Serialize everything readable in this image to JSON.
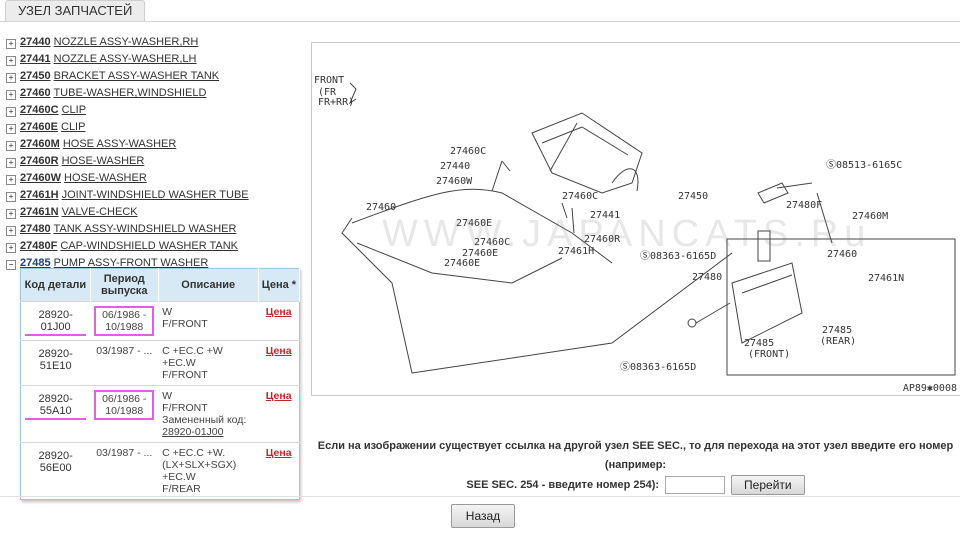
{
  "tab": {
    "title": "УЗЕЛ ЗАПЧАСТЕЙ"
  },
  "tree": [
    {
      "toggle": "+",
      "code": "27440",
      "name": "NOZZLE ASSY-WASHER,RH"
    },
    {
      "toggle": "+",
      "code": "27441",
      "name": "NOZZLE ASSY-WASHER,LH"
    },
    {
      "toggle": "+",
      "code": "27450",
      "name": "BRACKET ASSY-WASHER TANK"
    },
    {
      "toggle": "+",
      "code": "27460",
      "name": "TUBE-WASHER,WINDSHIELD"
    },
    {
      "toggle": "+",
      "code": "27460C",
      "name": "CLIP"
    },
    {
      "toggle": "+",
      "code": "27460E",
      "name": "CLIP"
    },
    {
      "toggle": "+",
      "code": "27460M",
      "name": "HOSE ASSY-WASHER"
    },
    {
      "toggle": "+",
      "code": "27460R",
      "name": "HOSE-WASHER"
    },
    {
      "toggle": "+",
      "code": "27460W",
      "name": "HOSE-WASHER"
    },
    {
      "toggle": "+",
      "code": "27461H",
      "name": "JOINT-WINDSHIELD WASHER TUBE"
    },
    {
      "toggle": "+",
      "code": "27461N",
      "name": "VALVE-CHECK"
    },
    {
      "toggle": "+",
      "code": "27480",
      "name": "TANK ASSY-WINDSHIELD WASHER"
    },
    {
      "toggle": "+",
      "code": "27480F",
      "name": "CAP-WINDSHIELD WASHER TANK"
    },
    {
      "toggle": "−",
      "code": "27485",
      "name": "PUMP ASSY-FRONT WASHER"
    }
  ],
  "table": {
    "headers": {
      "code": "Код детали",
      "period": "Период выпуска",
      "desc": "Описание",
      "price": "Цена *"
    },
    "rows": [
      {
        "code": "28920-01J00",
        "period": "06/1986 - 10/1988",
        "desc": [
          "W",
          "F/FRONT"
        ],
        "price": "Цена"
      },
      {
        "code": "28920-51E10",
        "period": "03/1987 - ...",
        "desc": [
          "C +EC.C +W +EC.W",
          "F/FRONT"
        ],
        "price": "Цена"
      },
      {
        "code": "28920-55A10",
        "period": "06/1986 - 10/1988",
        "desc": [
          "W",
          "F/FRONT",
          "Замененный код:"
        ],
        "replaced": "28920-01J00",
        "price": "Цена"
      },
      {
        "code": "28920-56E00",
        "period": "03/1987 - ...",
        "desc": [
          "C +EC.C +W.",
          "(LX+SLX+SGX)",
          "+EC.W",
          "F/REAR"
        ],
        "price": "Цена"
      }
    ]
  },
  "diagram": {
    "watermark": "WWW.JAPANCATS.Ru",
    "code": "AP89✱0008",
    "header_lines": [
      "FRONT",
      "(FR",
      "FR+RR)"
    ],
    "labels": [
      "27460C",
      "27440",
      "27460W",
      "27460",
      "27460E",
      "27460C",
      "27460R",
      "27460C",
      "27460E",
      "27461H",
      "27441",
      "27460C",
      "27450",
      "27480F",
      "27460M",
      "08513-6165C",
      "08363-6165D",
      "27460",
      "27461N",
      "27480",
      "27485",
      "(FRONT)",
      "27485",
      "(REAR)",
      "08363-6165D"
    ]
  },
  "note": {
    "line1": "Если на изображении существует ссылка на другой узел SEE SEC., то для перехода на этот узел введите его номер (например:",
    "line2": "SEE SEC. 254 - введите номер 254):",
    "input_value": "",
    "go_button": "Перейти"
  },
  "back_button": "Назад",
  "colors": {
    "highlight": "#e45ee4",
    "price_link": "#c0282c",
    "table_header": "#d6e9f5"
  }
}
